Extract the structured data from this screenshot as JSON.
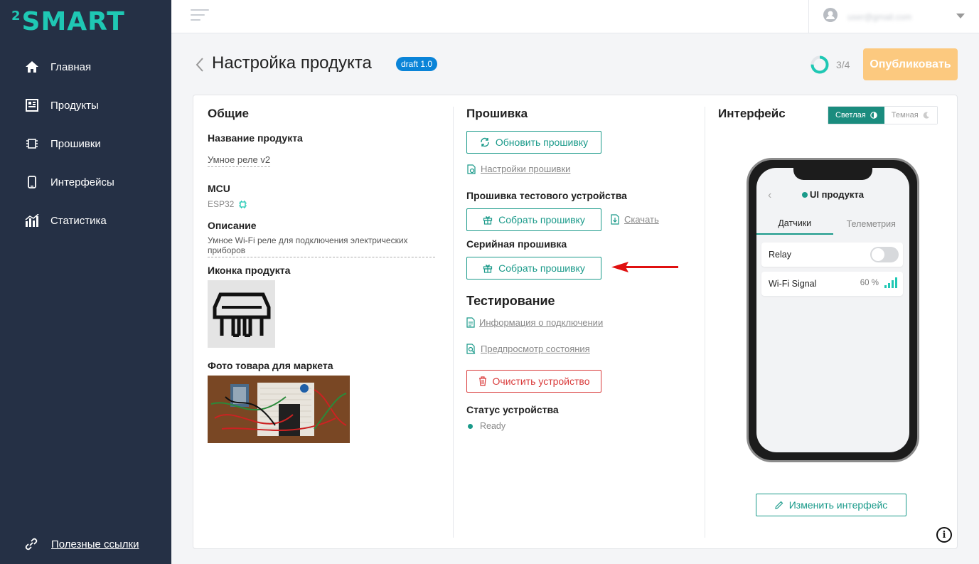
{
  "brand": {
    "logo_sup": "2",
    "logo_text": "SMART",
    "accent": "#1fc8b4"
  },
  "sidebar": {
    "items": [
      {
        "label": "Главная",
        "icon": "home-icon"
      },
      {
        "label": "Продукты",
        "icon": "products-icon"
      },
      {
        "label": "Прошивки",
        "icon": "chip-icon"
      },
      {
        "label": "Интерфейсы",
        "icon": "phone-icon"
      },
      {
        "label": "Статистика",
        "icon": "stats-icon"
      }
    ],
    "links_label": "Полезные ссылки"
  },
  "header": {
    "user_email": "user@gmail.com"
  },
  "page": {
    "title": "Настройка продукта",
    "badge": "draft 1.0",
    "progress": "3/4",
    "progress_fraction": 0.75,
    "publish_label": "Опубликовать"
  },
  "general": {
    "heading": "Общие",
    "name_label": "Название продукта",
    "name_value": "Умное реле v2",
    "mcu_label": "MCU",
    "mcu_value": "ESP32",
    "desc_label": "Описание",
    "desc_value": "Умное Wi-Fi реле для подключения электрических приборов",
    "icon_label": "Иконка продукта",
    "photo_label": "Фото товара для маркета"
  },
  "firmware": {
    "heading": "Прошивка",
    "update_btn": "Обновить прошивку",
    "settings_link": "Настройки прошивки",
    "test_label": "Прошивка тестового устройства",
    "build_btn": "Собрать прошивку",
    "download_link": "Скачать",
    "serial_label": "Серийная прошивка",
    "serial_build_btn": "Собрать прошивку",
    "testing_heading": "Тестирование",
    "conn_info_link": "Информация о подключении",
    "preview_link": "Предпросмотр состояния",
    "clear_btn": "Очистить устройство",
    "status_label": "Статус устройства",
    "status_value": "Ready"
  },
  "interface": {
    "heading": "Интерфейс",
    "theme_light": "Светлая",
    "theme_dark": "Темная",
    "phone_title": "UI продукта",
    "tabs": [
      "Датчики",
      "Телеметрия"
    ],
    "relay_label": "Relay",
    "wifi_label": "Wi-Fi Signal",
    "wifi_value": "60 %",
    "edit_btn": "Изменить интерфейс"
  }
}
